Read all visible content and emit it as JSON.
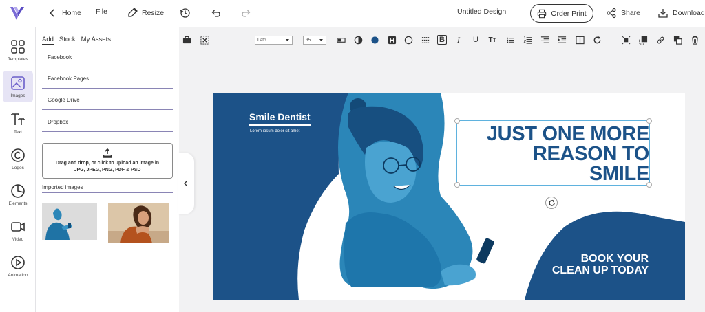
{
  "topbar": {
    "home": "Home",
    "file": "File",
    "resize": "Resize",
    "document_title": "Untitled Design",
    "order_print": "Order Print",
    "share": "Share",
    "download": "Download",
    "icons": [
      "logo-icon",
      "chevron-left-icon",
      "resize-icon",
      "history-icon",
      "undo-icon",
      "redo-icon",
      "printer-icon",
      "share-icon",
      "download-icon"
    ]
  },
  "leftrail": {
    "items": [
      {
        "label": "Templates",
        "icon": "templates-icon"
      },
      {
        "label": "Images",
        "icon": "images-icon",
        "active": true
      },
      {
        "label": "Text",
        "icon": "text-icon"
      },
      {
        "label": "Logos",
        "icon": "logos-icon"
      },
      {
        "label": "Elements",
        "icon": "elements-icon"
      },
      {
        "label": "Video",
        "icon": "video-icon"
      },
      {
        "label": "Animation",
        "icon": "animation-icon"
      }
    ]
  },
  "panel": {
    "tabs": [
      "Add",
      "Stock",
      "My Assets"
    ],
    "active_tab": "Add",
    "sources": [
      "Facebook",
      "Facebook Pages",
      "Google Drive",
      "Dropbox"
    ],
    "dropzone_line1": "Drag and drop, or click to upload an image in",
    "dropzone_line2": "JPG, JPEG, PNG, PDF & PSD",
    "imported_label": "Imported images"
  },
  "toolbar": {
    "font": "Lato",
    "font_size": "35",
    "bold_glyph": "B",
    "italic_glyph": "I",
    "underline_glyph": "U",
    "texttype_glyph": "Tт"
  },
  "design": {
    "brand_name": "Smile Dentist",
    "brand_tagline": "Lorem ipsum dolor sit amet",
    "headline_line1": "JUST ONE MORE",
    "headline_line2": "REASON TO",
    "headline_line3": "SMILE",
    "cta_line1": "BOOK YOUR",
    "cta_line2": "CLEAN UP TODAY"
  },
  "colors": {
    "brand_blue": "#1c5288",
    "photo_blue": "#2b86b8",
    "accent_purple": "#6a5ec9",
    "selection": "#5fb2de"
  }
}
